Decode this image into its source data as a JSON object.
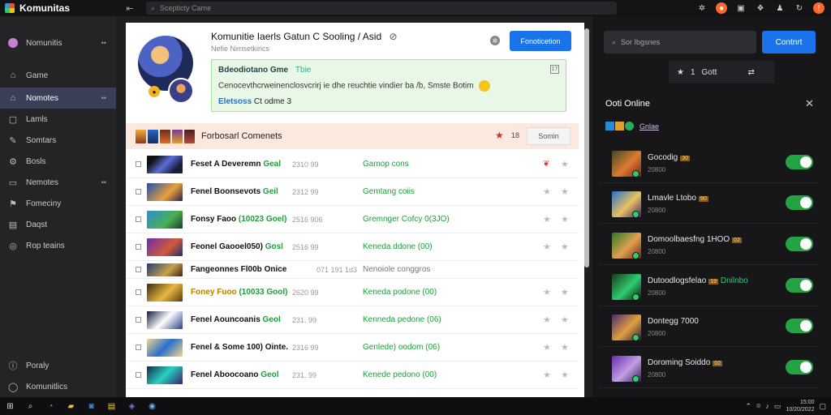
{
  "app": {
    "title": "Komunitas",
    "back_icon": "back-arrow-icon"
  },
  "search": {
    "placeholder": "Scepticty Came"
  },
  "sidebar": {
    "items": [
      {
        "label": "Nomunitis",
        "icon": "avatar-icon",
        "more": "••"
      },
      {
        "label": "Game",
        "icon": "home-icon"
      },
      {
        "label": "Nomotes",
        "icon": "community-icon",
        "more": "••",
        "active": true
      },
      {
        "label": "Lamls",
        "icon": "chat-icon"
      },
      {
        "label": "Somtars",
        "icon": "tools-icon"
      },
      {
        "label": "Bosls",
        "icon": "gear-icon"
      },
      {
        "label": "Nemotes",
        "icon": "box-icon",
        "more": "••"
      },
      {
        "label": "Fomeciny",
        "icon": "flag-icon"
      },
      {
        "label": "Daqst",
        "icon": "note-icon"
      },
      {
        "label": "Rop teains",
        "icon": "globe-icon"
      }
    ],
    "bottom": [
      {
        "label": "Poraly",
        "icon": "info-icon"
      },
      {
        "label": "Komunitlics",
        "icon": "circle-icon"
      }
    ]
  },
  "profile": {
    "title": "Komunitie Iaerls Gatun C Sooling / Asid",
    "title_icon": "⊘",
    "subtitle": "Nefie  Nimsetkirics",
    "follow_label": "Fonoticetion",
    "avatar_badge": "●"
  },
  "status": {
    "title": "Bdeodiotano Gme",
    "tag": "Tbie",
    "text": "Cenocevthcrweinenclosvcrirj ie dhe reuchtie vindier ba /b, Smste Botim",
    "link_prefix": "Eletsoss",
    "link_suffix": "Ct odme 3",
    "close": "17"
  },
  "featured": {
    "title": "Forbosarl Comenets",
    "count": "18",
    "sort_label": "Somin"
  },
  "rows": [
    {
      "title": "Feset A Deveremn",
      "tag": "Geal",
      "tag_color": "green",
      "meta": "2310  99",
      "status": "Gamop cons",
      "flag": true
    },
    {
      "title": "Fenel Boonsevots",
      "tag": "Geil",
      "tag_color": "green",
      "meta": "2312  99",
      "status": "Gemtang coiis"
    },
    {
      "title": "Fonsy Faoo",
      "tag": "(10023 Goel)",
      "tag_color": "green",
      "meta": "2516  906",
      "status": "Gremnger Cofcy 0(3JO)"
    },
    {
      "title": "Feonel Gaooel050)",
      "tag": "Gosl",
      "tag_color": "green",
      "meta": "2516  99",
      "status": "Keneda ddone (00)"
    },
    {
      "title": "Fangeonnes Fl00b Onice",
      "tag": "",
      "tag_color": "none",
      "meta": "071  191  1d3",
      "status": "Nenoiole conggros",
      "slim": true,
      "grey": true
    },
    {
      "title": "Foney Fuoo",
      "tag": "(10033 Gool)",
      "tag_color": "yellow",
      "meta": "2620  99",
      "status": "Keneda podone (00)"
    },
    {
      "title": "Fenel Aouncoanis",
      "tag": "Geol",
      "tag_color": "green",
      "meta": "231.  99",
      "status": "Kenneda pedone (06)"
    },
    {
      "title": "Fenel & Some 100) Ointe.",
      "tag": "",
      "tag_color": "none",
      "meta": "2316  99",
      "status": "Genlede) oodom (06)"
    },
    {
      "title": "Fenel Aboocoano",
      "tag": "Geol",
      "tag_color": "green",
      "meta": "231.  99",
      "status": "Kenede pedono (00)"
    }
  ],
  "right": {
    "search_placeholder": "Sor Ibgsnes",
    "button_label": "Contnrt",
    "tab_count": "1",
    "tab_label": "Gott",
    "online_title": "Ooti Online",
    "online_label": "Gnlae",
    "friends": [
      {
        "name": "Gocodig",
        "level": "30",
        "sub": "20800",
        "online_text": ""
      },
      {
        "name": "Lmavle Ltobo",
        "level": "90",
        "sub": "20800",
        "online_text": ""
      },
      {
        "name": "Domoolbaesfng 1HOO",
        "level": "02",
        "sub": "20800",
        "online_text": ""
      },
      {
        "name": "Dutoodlogsfelao",
        "level": "19",
        "sub": "20800",
        "online_text": "Dnilnbo"
      },
      {
        "name": "Dontegg 7000",
        "level": "",
        "sub": "20800",
        "online_text": ""
      },
      {
        "name": "Doroming Soiddo",
        "level": "02",
        "sub": "20800",
        "online_text": ""
      }
    ]
  },
  "taskbar": {
    "time": "15:00",
    "date": "10/20/2022"
  }
}
